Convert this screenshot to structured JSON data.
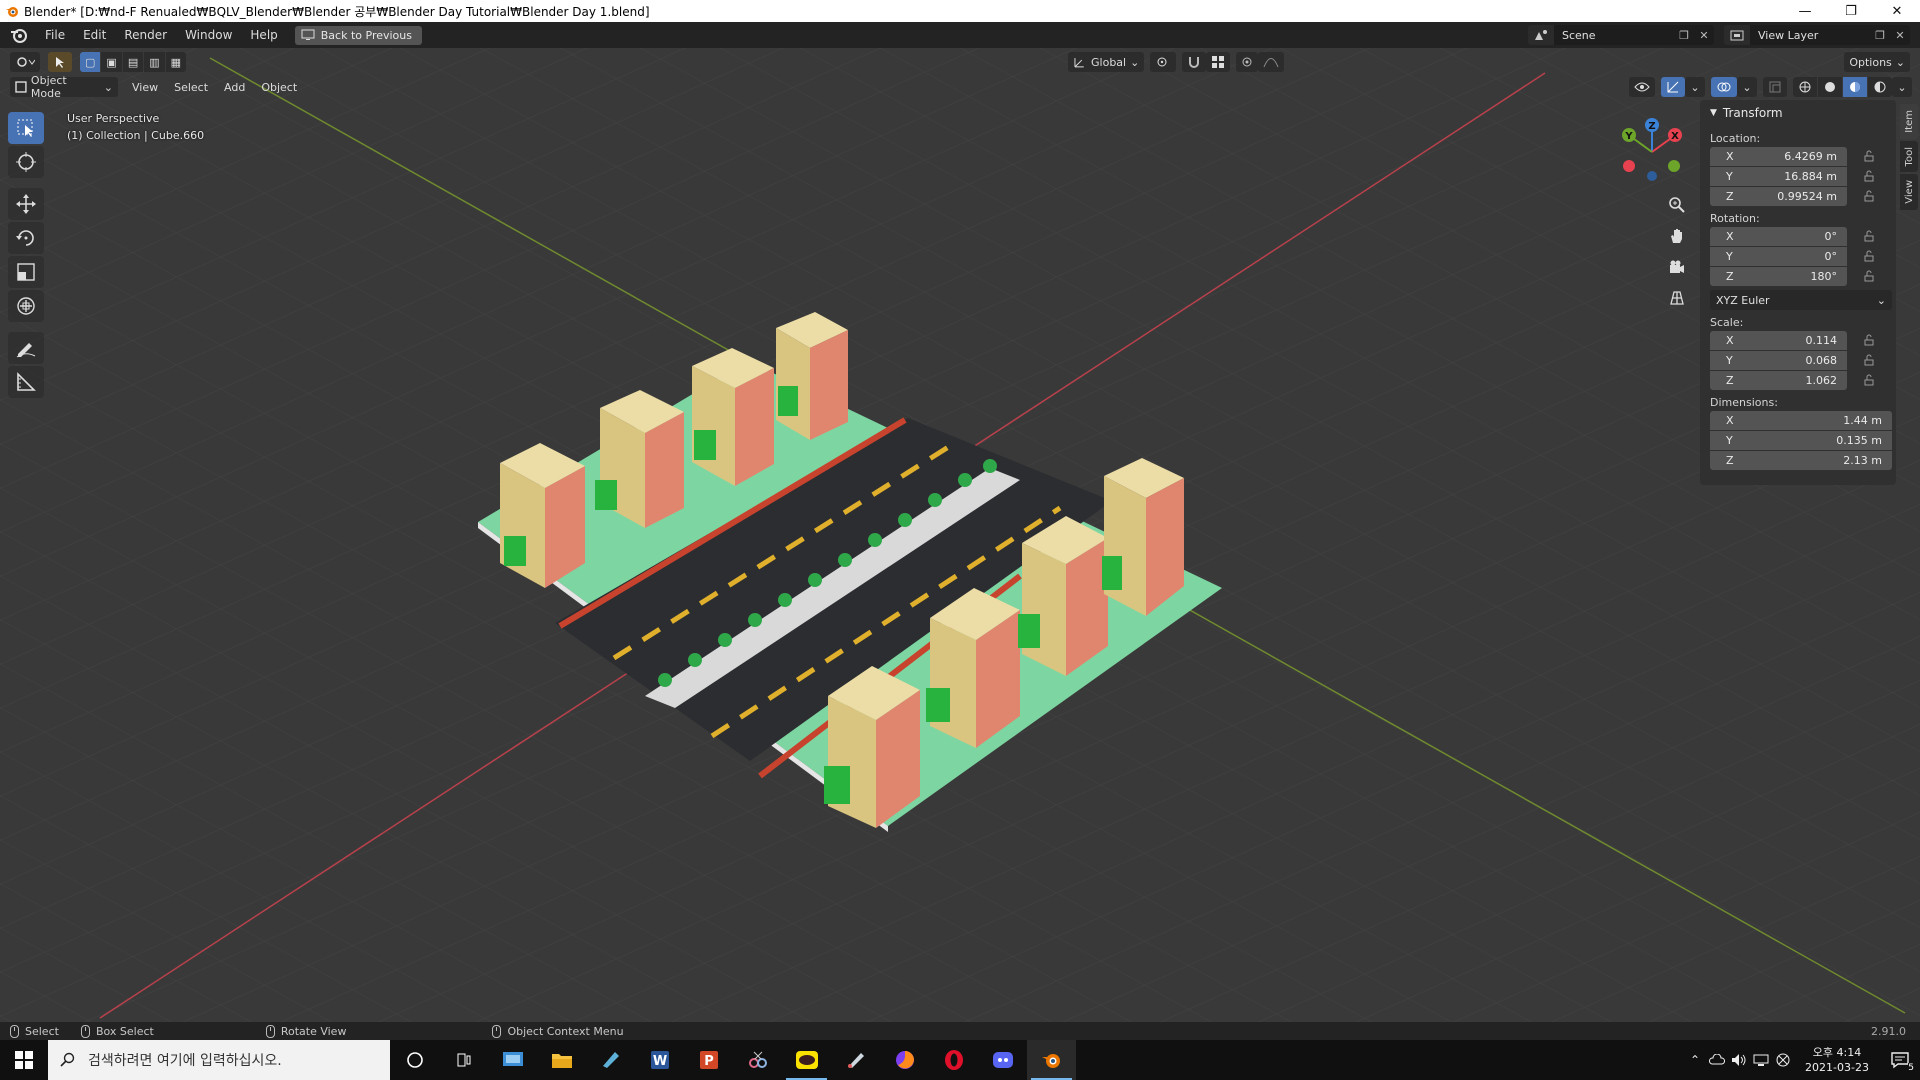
{
  "window": {
    "title": "Blender* [D:₩nd-F Renualed₩BQLV_Blender₩Blender 공부₩Blender Day Tutorial₩Blender Day 1.blend]",
    "minimize": "—",
    "restore": "❐",
    "close": "✕"
  },
  "topbar": {
    "menus": [
      "File",
      "Edit",
      "Render",
      "Window",
      "Help"
    ],
    "back_label": "Back to Previous",
    "scene_name": "Scene",
    "view_layer": "View Layer"
  },
  "viewport_header": {
    "orientation": "Global",
    "options_label": "Options",
    "mode": "Object Mode",
    "menus": [
      "View",
      "Select",
      "Add",
      "Object"
    ]
  },
  "overlay": {
    "view_name": "User Perspective",
    "collection": "(1) Collection | Cube.660"
  },
  "gizmo": {
    "x": "X",
    "y": "Y",
    "z": "Z",
    "colors": {
      "x": "#e8414f",
      "y": "#6da42a",
      "z": "#3b82d9"
    }
  },
  "sidebar": {
    "panel_title": "Transform",
    "location_label": "Location:",
    "location": [
      {
        "axis": "X",
        "value": "6.4269 m"
      },
      {
        "axis": "Y",
        "value": "16.884 m"
      },
      {
        "axis": "Z",
        "value": "0.99524 m"
      }
    ],
    "rotation_label": "Rotation:",
    "rotation": [
      {
        "axis": "X",
        "value": "0°"
      },
      {
        "axis": "Y",
        "value": "0°"
      },
      {
        "axis": "Z",
        "value": "180°"
      }
    ],
    "rotation_mode": "XYZ Euler",
    "scale_label": "Scale:",
    "scale": [
      {
        "axis": "X",
        "value": "0.114"
      },
      {
        "axis": "Y",
        "value": "0.068"
      },
      {
        "axis": "Z",
        "value": "1.062"
      }
    ],
    "dimensions_label": "Dimensions:",
    "dimensions": [
      {
        "axis": "X",
        "value": "1.44 m"
      },
      {
        "axis": "Y",
        "value": "0.135 m"
      },
      {
        "axis": "Z",
        "value": "2.13 m"
      }
    ],
    "tabs": [
      "Item",
      "Tool",
      "View"
    ]
  },
  "statusbar": {
    "select": "Select",
    "box_select": "Box Select",
    "rotate_view": "Rotate View",
    "context_menu": "Object Context Menu",
    "version": "2.91.0"
  },
  "taskbar": {
    "search_placeholder": "검색하려면 여기에 입력하십시오.",
    "time": "오후 4:14",
    "date": "2021-03-23",
    "notification_count": "5"
  }
}
